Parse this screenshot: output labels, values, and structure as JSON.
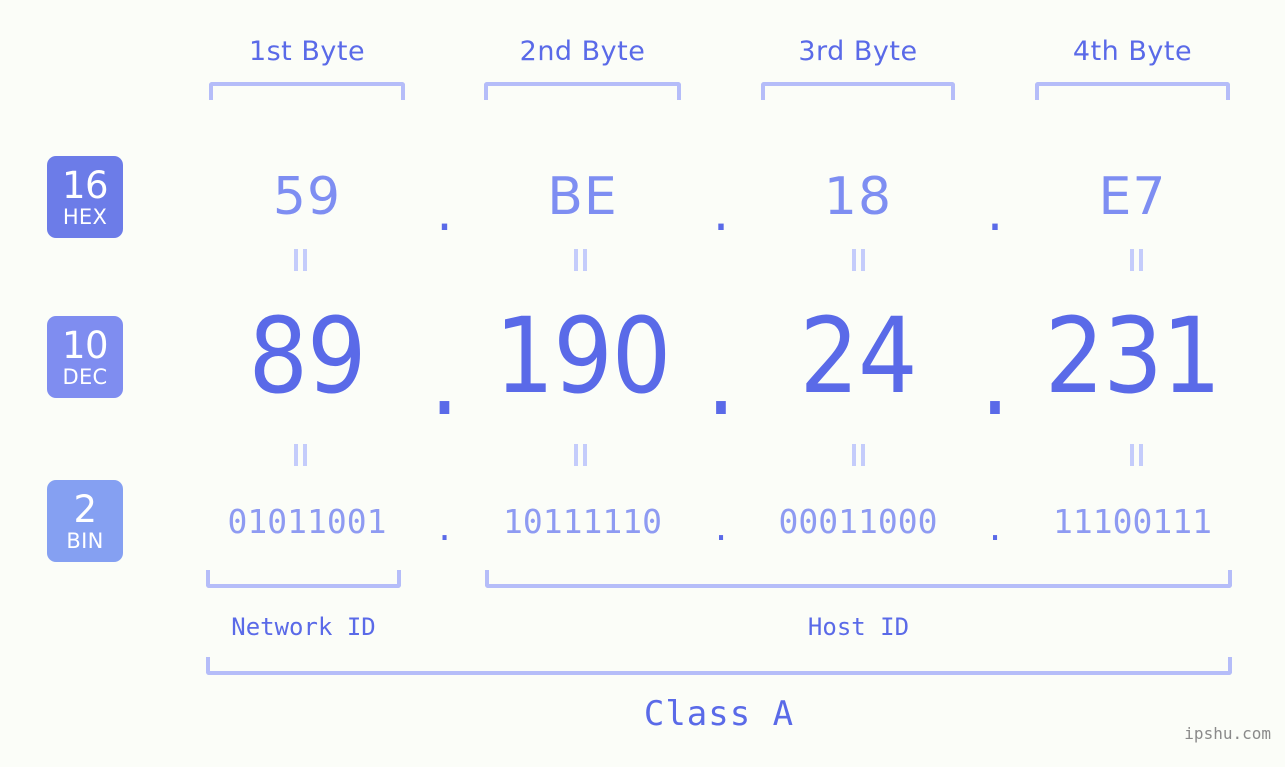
{
  "theme": {
    "background": "#fbfdf8",
    "accent": "#5a6ae8",
    "accent_light": "#8e9bf2",
    "bracket": "#b5bdf9",
    "badge_hex": "#6c7ce8",
    "badge_dec": "#7f8df0",
    "badge_bin": "#85a0f2"
  },
  "byte_headers": [
    {
      "label": "1st Byte"
    },
    {
      "label": "2nd Byte"
    },
    {
      "label": "3rd Byte"
    },
    {
      "label": "4th Byte"
    }
  ],
  "rows": {
    "hex": {
      "badge": {
        "number": "16",
        "name": "HEX"
      },
      "values": [
        "59",
        "BE",
        "18",
        "E7"
      ],
      "separator": "."
    },
    "dec": {
      "badge": {
        "number": "10",
        "name": "DEC"
      },
      "values": [
        "89",
        "190",
        "24",
        "231"
      ],
      "separator": "."
    },
    "bin": {
      "badge": {
        "number": "2",
        "name": "BIN"
      },
      "values": [
        "01011001",
        "10111110",
        "00011000",
        "11100111"
      ],
      "separator": "."
    }
  },
  "equality_mark": "=",
  "id_sections": [
    {
      "label": "Network ID"
    },
    {
      "label": "Host ID"
    }
  ],
  "class_label": "Class A",
  "watermark": "ipshu.com"
}
